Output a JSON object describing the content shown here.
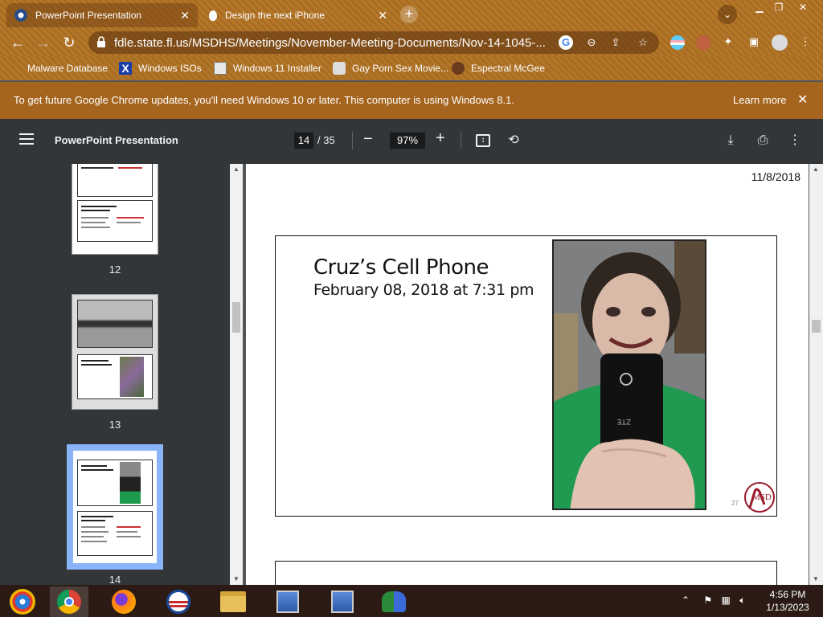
{
  "browser": {
    "tabs": [
      {
        "title": "PowerPoint Presentation",
        "active": true
      },
      {
        "title": "Design the next iPhone",
        "active": false
      }
    ],
    "new_tab_symbol": "+",
    "url": "fdle.state.fl.us/MSDHS/Meetings/November-Meeting-Documents/Nov-14-1045-...",
    "bookmarks": [
      {
        "label": "Malware Database"
      },
      {
        "label": "Windows ISOs"
      },
      {
        "label": "Windows 11 Installer"
      },
      {
        "label": "Gay Porn Sex Movie..."
      },
      {
        "label": "Espectral McGee"
      }
    ],
    "infobar": {
      "message": "To get future Google Chrome updates, you'll need Windows 10 or later. This computer is using Windows 8.1.",
      "link": "Learn more"
    }
  },
  "pdf": {
    "title": "PowerPoint Presentation",
    "current_page": "14",
    "total_pages": "/ 35",
    "zoom": "97%",
    "thumbnails": [
      {
        "number": "12"
      },
      {
        "number": "13"
      },
      {
        "number": "14",
        "selected": true
      }
    ],
    "page_date": "11/8/2018",
    "slide": {
      "title": "Cruz’s Cell Phone",
      "subtitle": "February 08, 2018 at 7:31 pm",
      "slide_number": "27",
      "logo_text": "MSD",
      "phone_brand": "ZTE"
    }
  },
  "taskbar": {
    "apps": [
      "windows-start",
      "chrome",
      "firefox",
      "obama-logo",
      "file-explorer",
      "network-computer",
      "network-computer-2",
      "people"
    ],
    "clock_time": "4:56 PM",
    "clock_date": "1/13/2023"
  },
  "colors": {
    "theme_brown": "#a86c22",
    "pdf_toolbar": "#323639",
    "pdf_background": "#525659",
    "selected_thumb": "#8ab4f8"
  }
}
